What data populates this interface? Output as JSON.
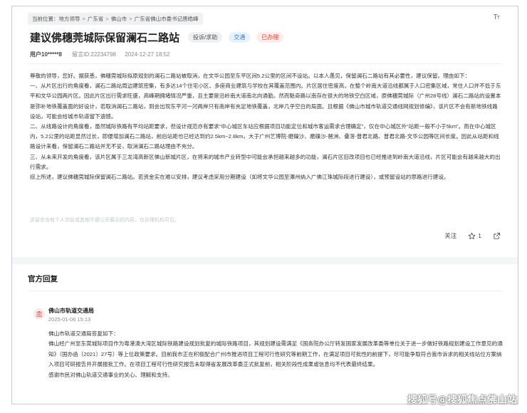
{
  "breadcrumb": {
    "prefix": "当前位置：",
    "items": [
      "地方领导",
      "广东省",
      "佛山市",
      "广东省佛山市委书记唐皓峰"
    ]
  },
  "font_size_icon": "font-size-icon",
  "post": {
    "title": "建议佛穗莞城际保留澜石二路站",
    "tags": [
      "投诉/求助",
      "交通",
      "已办理"
    ],
    "user": "用户10*****8",
    "message_id": "留言ID:22234798",
    "datetime": "2024-12-27 18:52",
    "paragraphs": [
      "尊敬的领导，您好。据获悉，佛穗莞城际拟原规划的澜石二路站被取消，在文华公园至东平区间5.2公里的区间不设站。以本人愚见，保留澜石二路站有其必要性，建议保留。理由如下：",
      "一、从片区出行的角度看，澜石二路站周边建筑密集，有多达14个住宅小区、多座商业建筑与学校在其覆盖范围内。片区居住密度高，在整个岭南大道沿线都属于人口密集区域，常住人口并不低于东平和文华公园两片区。因此片区出行需求旺盛，高峰期拥堵情况严重，且主要是沿岭南大道南北向通勤。然而魁奇路以南存在很大的地铁空白区域，原佛穗莞城际（广州28号线）澜石二路站的设置本是弥补地铁覆盖面的好设计，若取消澜石二路站，则会出现东平河一河两岸只有南岸有充足地铁覆盖，北岸几乎空白的局面。且根据《佛山市城市轨道交通线网规划修编》，该片区不会有新地铁线路设站，可能会给城市轨道留下遗憾。",
      "二、从线路设计的角度看，虽然城际铁路有平均站距要求，但设计规范亦有要求“中心城区车站应根据项目功能定位和城市客运需求合理确定”，仅在中心城区外“站距一般不小于5km”。而在中心城区内，5.2公里的站距显然过长，即便增加澜石二路站，前后站距也已经达到约2.5km~2.8km，大于广州艺博院-磨碟沙、磨碟沙-琶洲、叠滘-普君北路、普君北路-文华公园等区间长度。因此从站距和线路设计来看，保留澜石二路站并无不妥，取消澜石二路站理由不充分。",
      "三、从未来开发的角度看，该片区属于三龙湾高新区佛山新城片区，在将来的城市产业转型中可能会承担越来越多的功能，澜石片区旧改项目也已经推进到岭南大道沿线，片区可能会有越来越大的出行需求。",
      "综上所述，建议佛穗莞城际保留澜石二路站。若资金实在难以安排，建议考虑采用分期建设（如将文华公园至潭州纳入广佛江珠城际段进行建设），或预留设站的思路进行建设。"
    ],
    "notice": "该留言含有个人信息或其他不便公开展示的内容，仅办理机构可见。",
    "actions": {
      "follow_label": "关注",
      "like_count": "1"
    }
  },
  "reply": {
    "heading": "官方回复",
    "org_name": "佛山市轨道交通局",
    "date": "2025-01-06 15:13",
    "paragraphs": [
      "佛山市轨道交通局答复如下：",
      "佛山经广州至东莞城际项目作为粤港澳大湾区城际铁路建设规划批复的城际铁路项目，其规划建设需满足《国务院办公厅转发国家发展改革委等单位关于进一步做好铁路规划建设工作意见的通知》（国办函〔2021〕27号）等上位政策要求。目前我市正在积极配合广州市推进项目工程可行性研究等前期工作，在满足项目可批性的前提下，尽可能争取符合我市诉求的相关线站位方案纳入项目可研报告并开展报批工作。在项目工程可行性研究报告未取得省发展改革委正式批复前，相关阶段性成果或信息均不代表最终结果。",
      "感谢市民对佛山轨道交通事业的关心、理解和支持。"
    ]
  },
  "watermark": "搜狐号@搜狐焦点佛山站",
  "colors": {
    "tag_blue": "#2f7ed8",
    "tag_red": "#e0443a",
    "org_icon": "#d9534f"
  }
}
